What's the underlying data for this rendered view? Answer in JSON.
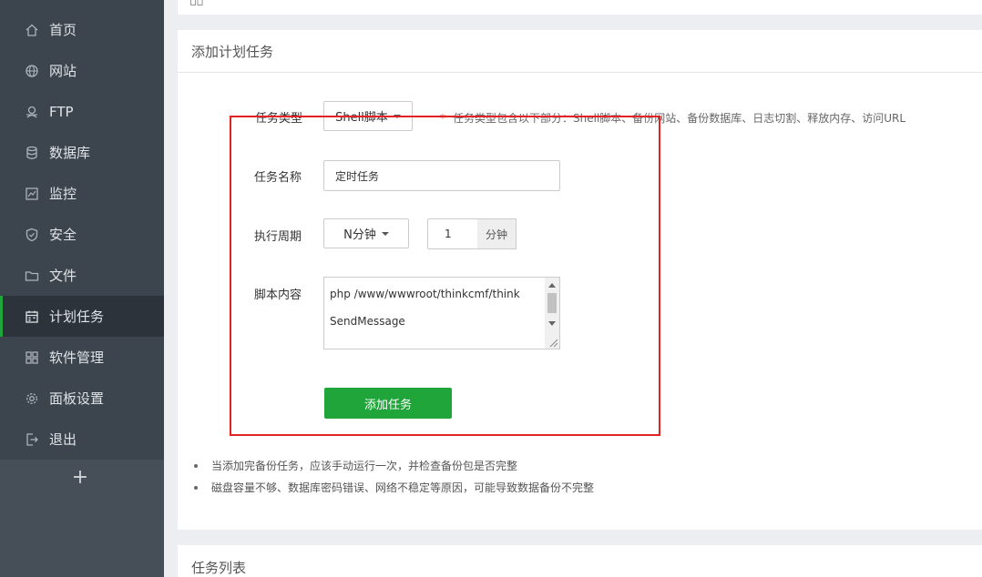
{
  "sidebar": {
    "items": [
      {
        "label": "首页",
        "icon": "home-icon"
      },
      {
        "label": "网站",
        "icon": "globe-icon"
      },
      {
        "label": "FTP",
        "icon": "ftp-icon"
      },
      {
        "label": "数据库",
        "icon": "database-icon"
      },
      {
        "label": "监控",
        "icon": "monitor-icon"
      },
      {
        "label": "安全",
        "icon": "shield-icon"
      },
      {
        "label": "文件",
        "icon": "folder-icon"
      },
      {
        "label": "计划任务",
        "icon": "calendar-icon",
        "active": true
      },
      {
        "label": "软件管理",
        "icon": "grid-icon"
      },
      {
        "label": "面板设置",
        "icon": "gear-icon"
      },
      {
        "label": "退出",
        "icon": "logout-icon"
      }
    ],
    "add_label": "+"
  },
  "form": {
    "title": "添加计划任务",
    "task_type": {
      "label": "任务类型",
      "value": "Shell脚本"
    },
    "task_type_hint": {
      "star": "*",
      "text": "任务类型包含以下部分：Shell脚本、备份网站、备份数据库、日志切割、释放内存、访问URL"
    },
    "task_name": {
      "label": "任务名称",
      "value": "定时任务"
    },
    "cycle": {
      "label": "执行周期",
      "value": "N分钟",
      "minutes": "1",
      "unit": "分钟"
    },
    "script": {
      "label": "脚本内容",
      "lines": [
        "php /www/wwwroot/thinkcmf/think",
        "SendMessage"
      ]
    },
    "submit_label": "添加任务"
  },
  "tips": [
    "当添加完备份任务，应该手动运行一次，并检查备份包是否完整",
    "磁盘容量不够、数据库密码错误、网络不稳定等原因，可能导致数据备份不完整"
  ],
  "task_list": {
    "title": "任务列表"
  },
  "colors": {
    "accent": "#20a53a",
    "sidebar_bg": "#3c444d",
    "highlight": "#e02424"
  }
}
